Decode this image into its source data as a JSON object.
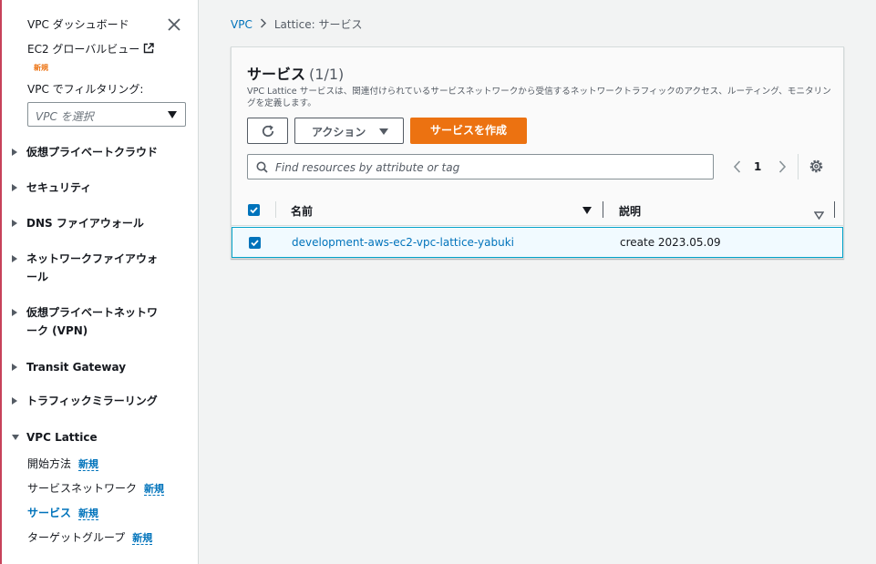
{
  "sidebar": {
    "dashboard": "VPC ダッシュボード",
    "ec2_global": "EC2 グローバルビュー",
    "ec2_new": "新規",
    "filter_label": "VPC でフィルタリング:",
    "filter_placeholder": "VPC を選択",
    "sections": [
      {
        "label": "仮想プライベートクラウド",
        "expanded": false
      },
      {
        "label": "セキュリティ",
        "expanded": false
      },
      {
        "label": "DNS ファイアウォール",
        "expanded": false
      },
      {
        "label_lines": [
          "ネットワークファイアウォ",
          "ール"
        ],
        "expanded": false
      },
      {
        "label_lines": [
          "仮想プライベートネットワ",
          "ーク (VPN)"
        ],
        "expanded": false
      },
      {
        "label": "Transit Gateway",
        "expanded": false
      },
      {
        "label": "トラフィックミラーリング",
        "expanded": false
      },
      {
        "label": "VPC Lattice",
        "expanded": true
      }
    ],
    "lattice_items": [
      {
        "label": "開始方法",
        "badge": "新規",
        "active": false
      },
      {
        "label": "サービスネットワーク",
        "badge": "新規",
        "active": false
      },
      {
        "label": "サービス",
        "badge": "新規",
        "active": true
      },
      {
        "label": "ターゲットグループ",
        "badge": "新規",
        "active": false
      }
    ]
  },
  "breadcrumb": {
    "root": "VPC",
    "current": "Lattice: サービス"
  },
  "panel": {
    "title": "サービス",
    "count": "(1/1)",
    "description": "VPC Lattice サービスは、関連付けられているサービスネットワークから受信するネットワークトラフィックのアクセス、ルーティング、モニタリングを定義します。",
    "actions_label": "アクション",
    "create_label": "サービスを作成",
    "search_placeholder": "Find resources by attribute or tag",
    "page": "1"
  },
  "table": {
    "columns": [
      "名前",
      "説明"
    ],
    "rows": [
      {
        "name": "development-aws-ec2-vpc-lattice-yabuki",
        "description": "create 2023.05.09",
        "selected": true
      }
    ]
  },
  "colors": {
    "accent": "#0073bb",
    "primary_button": "#ec7211",
    "selected_row_bg": "#f1faff",
    "selected_row_border": "#00a1c9"
  }
}
